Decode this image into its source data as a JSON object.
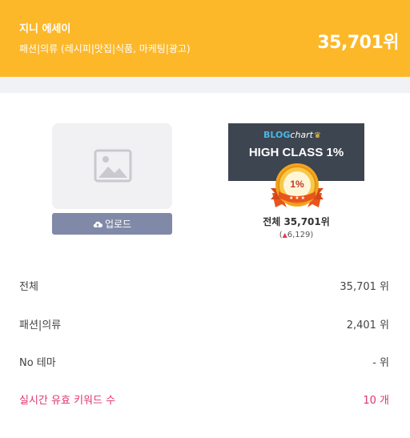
{
  "header": {
    "blog_name": "지니 에세이",
    "category": "패션|의류 (레시피|맛집|식품, 마케팅|광고)",
    "rank": "35,701위"
  },
  "profile": {
    "photo_icon": "image-placeholder-icon",
    "upload_label": "업로드",
    "upload_icon": "cloud-upload-icon"
  },
  "badge": {
    "logo_blog": "BLOG",
    "logo_chart": "chart",
    "class_text": "HIGH CLASS 1%",
    "medal_text": "1%",
    "overall_rank": "전체 35,701위",
    "change_arrow": "▲",
    "change_value": "6,129",
    "change_open": "(",
    "change_close": ")"
  },
  "stats": [
    {
      "label": "전체",
      "value": "35,701 위"
    },
    {
      "label": "패션|의류",
      "value": "2,401 위"
    },
    {
      "label": "No 테마",
      "value": "- 위"
    },
    {
      "label": "실시간 유효 키워드 수",
      "value": "10 개"
    }
  ],
  "colors": {
    "header_bg": "#fcb829",
    "badge_bg": "#3d4550",
    "accent_pink": "#e2346b",
    "button_bg": "#8089a8"
  }
}
